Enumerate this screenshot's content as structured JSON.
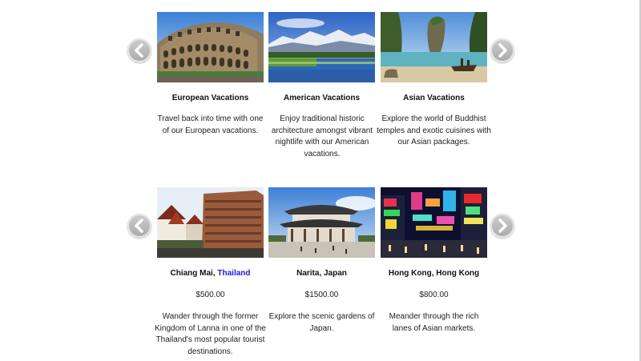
{
  "top_carousel": {
    "prev_label": "previous",
    "next_label": "next",
    "cards": [
      {
        "title": "European Vacations",
        "description": "Travel back into time with one of our European vacations.",
        "image": "colosseum"
      },
      {
        "title": "American Vacations",
        "description": "Enjoy traditional historic architecture amongst vibrant nightlife with our American vacations.",
        "image": "mountain-lake"
      },
      {
        "title": "Asian Vacations",
        "description": "Explore the world of Buddhist temples and exotic cuisines with our Asian packages.",
        "image": "limestone-islands"
      }
    ]
  },
  "bottom_carousel": {
    "prev_label": "previous",
    "next_label": "next",
    "cards": [
      {
        "title_prefix": "Chiang Mai, ",
        "title_link": "Thailand",
        "price": "$500.00",
        "description": "Wander through the former Kingdom of Lanna in one of the Thailand's most popular tourist destinations.",
        "image": "chiang-mai-temple"
      },
      {
        "title": "Narita, Japan",
        "price": "$1500.00",
        "description": "Explore the scenic gardens of Japan.",
        "image": "japanese-temple"
      },
      {
        "title": "Hong Kong, Hong Kong",
        "price": "$800.00",
        "description": "Meander through the rich lanes of Asian markets.",
        "image": "hong-kong-night-street"
      }
    ]
  },
  "colors": {
    "link": "#1a1ad6",
    "arrow": "#b5b5b5"
  }
}
